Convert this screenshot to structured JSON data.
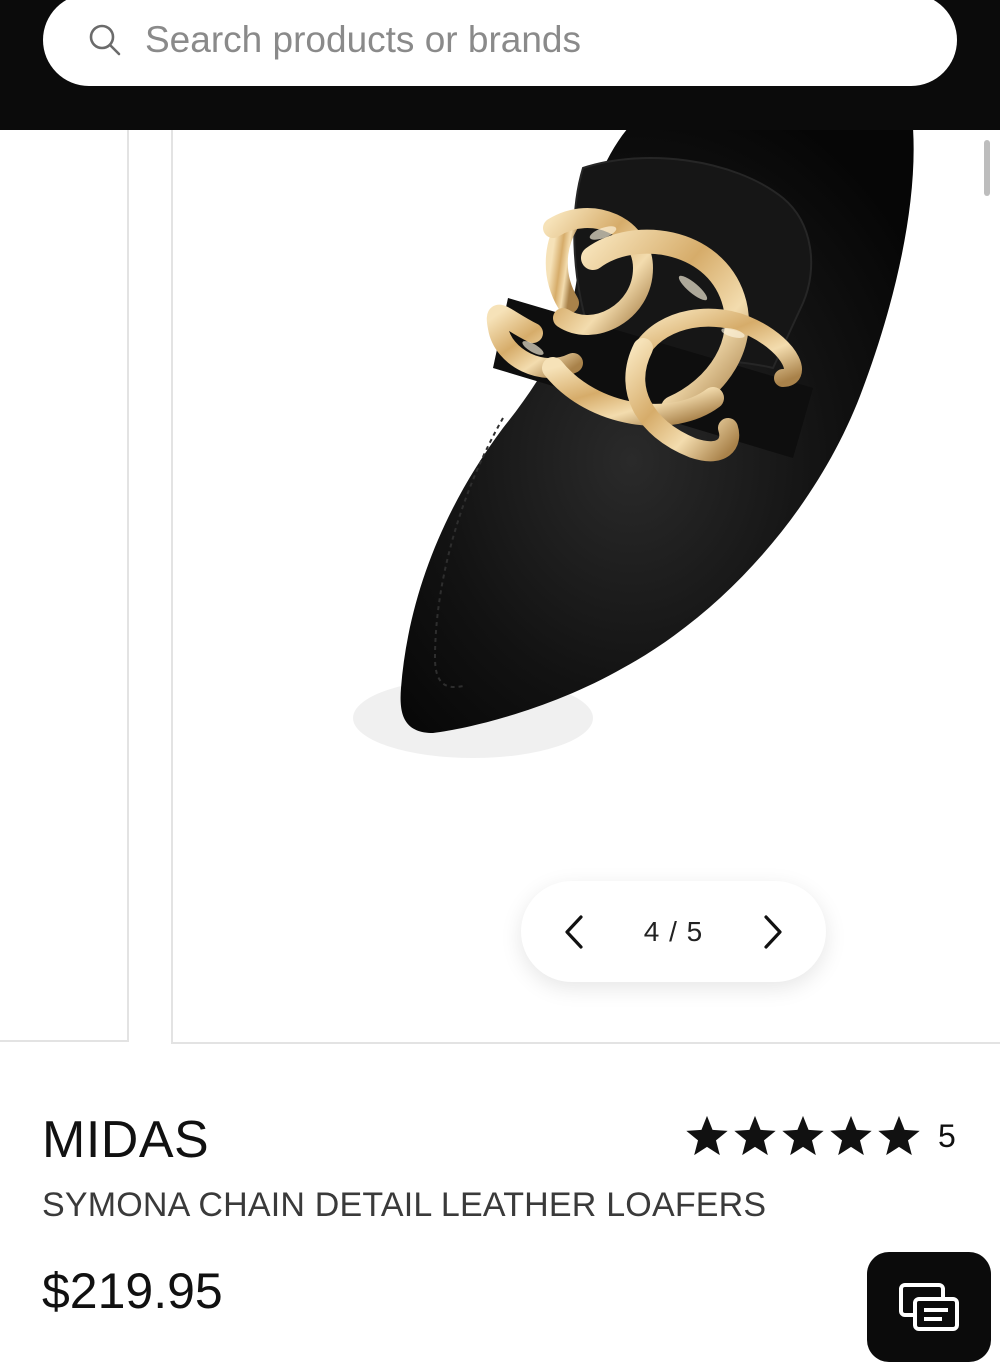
{
  "search": {
    "placeholder": "Search products or brands",
    "icon": "search-icon"
  },
  "gallery": {
    "current_image": 4,
    "total_images": 5,
    "counter_text": "4 / 5",
    "prev_icon": "chevron-left-icon",
    "next_icon": "chevron-right-icon"
  },
  "product": {
    "brand": "MIDAS",
    "name": "SYMONA CHAIN DETAIL LEATHER LOAFERS",
    "price": "$219.95",
    "rating": {
      "stars": 5,
      "max_stars": 5,
      "review_count": "5"
    }
  },
  "chat": {
    "icon": "chat-icon"
  },
  "colors": {
    "header_bg": "#0b0b0b",
    "accent": "#111111",
    "gold": "#d8b47a"
  }
}
